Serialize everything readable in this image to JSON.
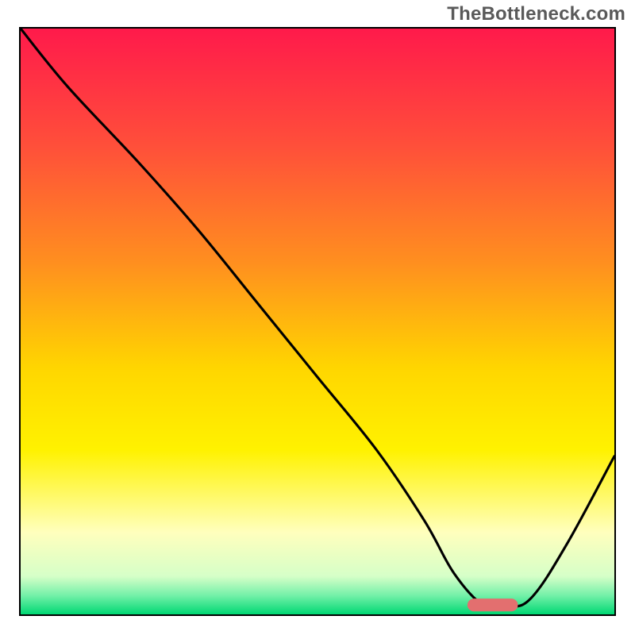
{
  "watermark": {
    "text": "TheBottleneck.com"
  },
  "chart_data": {
    "type": "line",
    "title": "",
    "xlabel": "",
    "ylabel": "",
    "xlim": [
      0,
      100
    ],
    "ylim": [
      0,
      100
    ],
    "grid": false,
    "legend": false,
    "background_gradient": {
      "stops": [
        {
          "offset": 0.0,
          "color": "#ff1a4b"
        },
        {
          "offset": 0.2,
          "color": "#ff4f3a"
        },
        {
          "offset": 0.4,
          "color": "#ff8f1f"
        },
        {
          "offset": 0.58,
          "color": "#ffd600"
        },
        {
          "offset": 0.72,
          "color": "#fff200"
        },
        {
          "offset": 0.86,
          "color": "#ffffbd"
        },
        {
          "offset": 0.935,
          "color": "#d6ffc8"
        },
        {
          "offset": 0.968,
          "color": "#73f0a8"
        },
        {
          "offset": 1.0,
          "color": "#00d873"
        }
      ]
    },
    "series": [
      {
        "name": "bottleneck-curve",
        "x": [
          0,
          8,
          20,
          30,
          40,
          50,
          60,
          68,
          73,
          78,
          82,
          86,
          92,
          100
        ],
        "y": [
          100,
          90,
          77,
          65.5,
          53,
          40.5,
          28,
          16,
          7,
          1.5,
          1.3,
          2.8,
          12,
          27
        ]
      }
    ],
    "marker": {
      "name": "optimal-range",
      "shape": "pill",
      "x_center": 79.5,
      "y_center": 1.6,
      "width": 8.5,
      "height": 2.2,
      "color": "#e36f6f"
    },
    "annotations": []
  }
}
